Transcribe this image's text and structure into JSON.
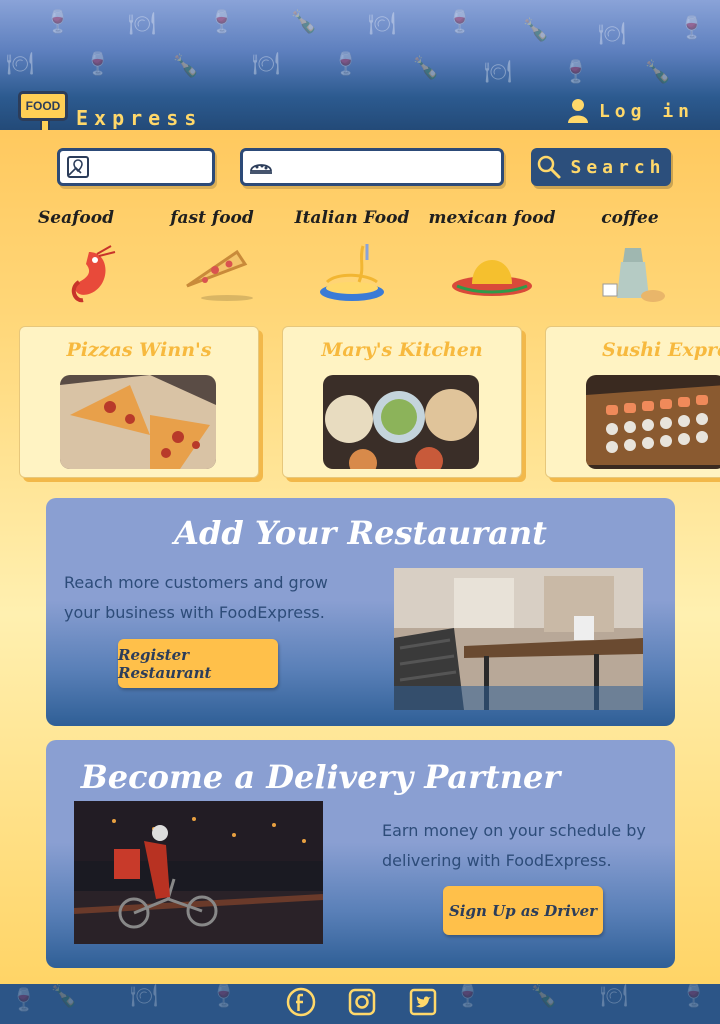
{
  "brand": {
    "logo_sign": "FOOD",
    "logo_text": "Express"
  },
  "header": {
    "login_label": "Log in"
  },
  "search": {
    "location_placeholder": "",
    "food_placeholder": "",
    "button_label": "Search"
  },
  "categories": [
    {
      "label": "Seafood",
      "icon": "shrimp-icon"
    },
    {
      "label": "fast food",
      "icon": "pizza-slice-icon"
    },
    {
      "label": "Italian Food",
      "icon": "pasta-icon"
    },
    {
      "label": "mexican food",
      "icon": "sombrero-icon"
    },
    {
      "label": "coffee",
      "icon": "coffee-icon"
    }
  ],
  "restaurants": [
    {
      "name": "Pizzas Winn's",
      "image": "pizza-photo"
    },
    {
      "name": "Mary's Kitchen",
      "image": "dishes-photo"
    },
    {
      "name": "Sushi Express",
      "image": "sushi-photo"
    }
  ],
  "add_restaurant": {
    "title": "Add Your Restaurant",
    "text_line1": "Reach more customers and grow",
    "text_line2": "your business with FoodExpress.",
    "button": "Register Restaurant"
  },
  "delivery": {
    "title": "Become a Delivery Partner",
    "text_line1": "Earn money on your schedule by",
    "text_line2": "delivering with FoodExpress.",
    "button": "Sign Up as Driver"
  },
  "footer": {
    "social": [
      "facebook-icon",
      "instagram-icon",
      "twitter-icon"
    ]
  },
  "colors": {
    "accent": "#ffc04a",
    "navy": "#2c4f7c",
    "panel": "#8a9fd2"
  }
}
